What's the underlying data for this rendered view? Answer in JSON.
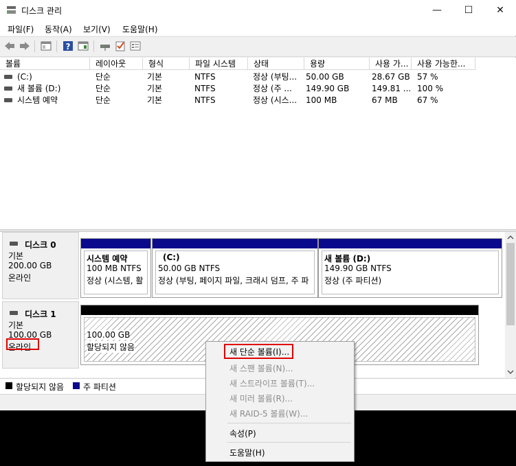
{
  "window": {
    "title": "디스크 관리",
    "controls": {
      "minimize": "—",
      "maximize": "☐",
      "close": "✕"
    }
  },
  "menu": [
    "파일(F)",
    "동작(A)",
    "보기(V)",
    "도움말(H)"
  ],
  "toolbar": {
    "icons": [
      "back-icon",
      "forward-icon",
      "show-hide-tree-icon",
      "help-icon",
      "show-hide-action-pane-icon",
      "connect-drive-icon",
      "checklist-icon",
      "properties-icon"
    ]
  },
  "volume_list": {
    "columns": [
      "볼륨",
      "레이아웃",
      "형식",
      "파일 시스템",
      "상태",
      "용량",
      "사용 가...",
      "사용 가능한..."
    ],
    "rows": [
      {
        "volume": "(C:)",
        "layout": "단순",
        "type": "기본",
        "fs": "NTFS",
        "status": "정상 (부팅...",
        "capacity": "50.00 GB",
        "free": "28.67 GB",
        "pct": "57 %"
      },
      {
        "volume": "새 볼륨 (D:)",
        "layout": "단순",
        "type": "기본",
        "fs": "NTFS",
        "status": "정상 (주 ...",
        "capacity": "149.90 GB",
        "free": "149.81 ...",
        "pct": "100 %"
      },
      {
        "volume": "시스템 예약",
        "layout": "단순",
        "type": "기본",
        "fs": "NTFS",
        "status": "정상 (시스...",
        "capacity": "100 MB",
        "free": "67 MB",
        "pct": "67 %"
      }
    ]
  },
  "disks": [
    {
      "name": "디스크 0",
      "type": "기본",
      "size": "200.00 GB",
      "status": "온라인",
      "partitions": [
        {
          "title": "시스템 예약",
          "line1": "100 MB NTFS",
          "line2": "정상 (시스템, 활"
        },
        {
          "title": "(C:)",
          "line1": "50.00 GB NTFS",
          "line2": "정상 (부팅, 페이지 파일, 크래시 덤프, 주 파"
        },
        {
          "title": "새 볼륨  (D:)",
          "line1": "149.90 GB NTFS",
          "line2": "정상 (주 파티션)"
        }
      ]
    },
    {
      "name": "디스크 1",
      "type": "기본",
      "size": "100.00 GB",
      "status": "온라인",
      "partitions": [
        {
          "title": "",
          "line1": "100.00 GB",
          "line2": "할당되지 않음"
        }
      ]
    }
  ],
  "legend": [
    {
      "label": "할당되지 않음",
      "color": "#000000"
    },
    {
      "label": "주 파티션",
      "color": "#0a0a8c"
    }
  ],
  "context_menu": {
    "items": [
      {
        "label": "새 단순 볼륨(I)...",
        "enabled": true
      },
      {
        "label": "새 스팬 볼륨(N)...",
        "enabled": false
      },
      {
        "label": "새 스트라이프 볼륨(T)...",
        "enabled": false
      },
      {
        "label": "새 미러 볼륨(R)...",
        "enabled": false
      },
      {
        "label": "새 RAID-5 볼륨(W)...",
        "enabled": false
      },
      {
        "label": "속성(P)",
        "enabled": true
      },
      {
        "label": "도움말(H)",
        "enabled": true
      }
    ]
  },
  "colors": {
    "primary_partition": "#0a0a8c",
    "unallocated": "#000000",
    "highlight": "#e00000"
  }
}
